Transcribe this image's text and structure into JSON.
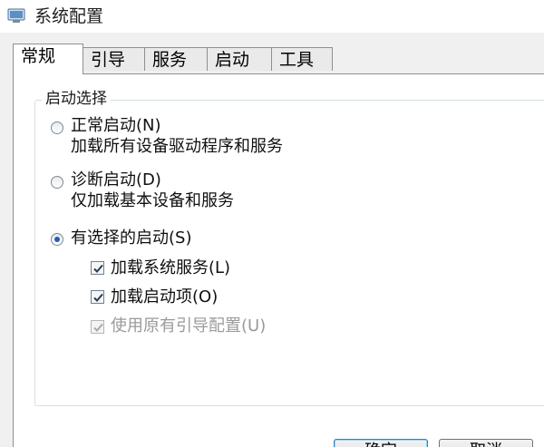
{
  "window": {
    "title": "系统配置"
  },
  "tabs": [
    {
      "label": "常规",
      "active": true
    },
    {
      "label": "引导",
      "active": false
    },
    {
      "label": "服务",
      "active": false
    },
    {
      "label": "启动",
      "active": false
    },
    {
      "label": "工具",
      "active": false
    }
  ],
  "startup": {
    "group_label": "启动选择",
    "options": [
      {
        "label": "正常启动(N)",
        "description": "加载所有设备驱动程序和服务",
        "selected": false
      },
      {
        "label": "诊断启动(D)",
        "description": "仅加载基本设备和服务",
        "selected": false
      },
      {
        "label": "有选择的启动(S)",
        "selected": true
      }
    ],
    "checkboxes": [
      {
        "label": "加载系统服务(L)",
        "checked": true,
        "enabled": true
      },
      {
        "label": "加载启动项(O)",
        "checked": true,
        "enabled": true
      },
      {
        "label": "使用原有引导配置(U)",
        "checked": true,
        "enabled": false
      }
    ]
  },
  "buttons": {
    "ok": "确定",
    "cancel": "取消"
  },
  "colors": {
    "radio_dot": "#1e5fb8",
    "check_mark": "#2a3a58",
    "disabled_text": "#9a9a9a"
  }
}
